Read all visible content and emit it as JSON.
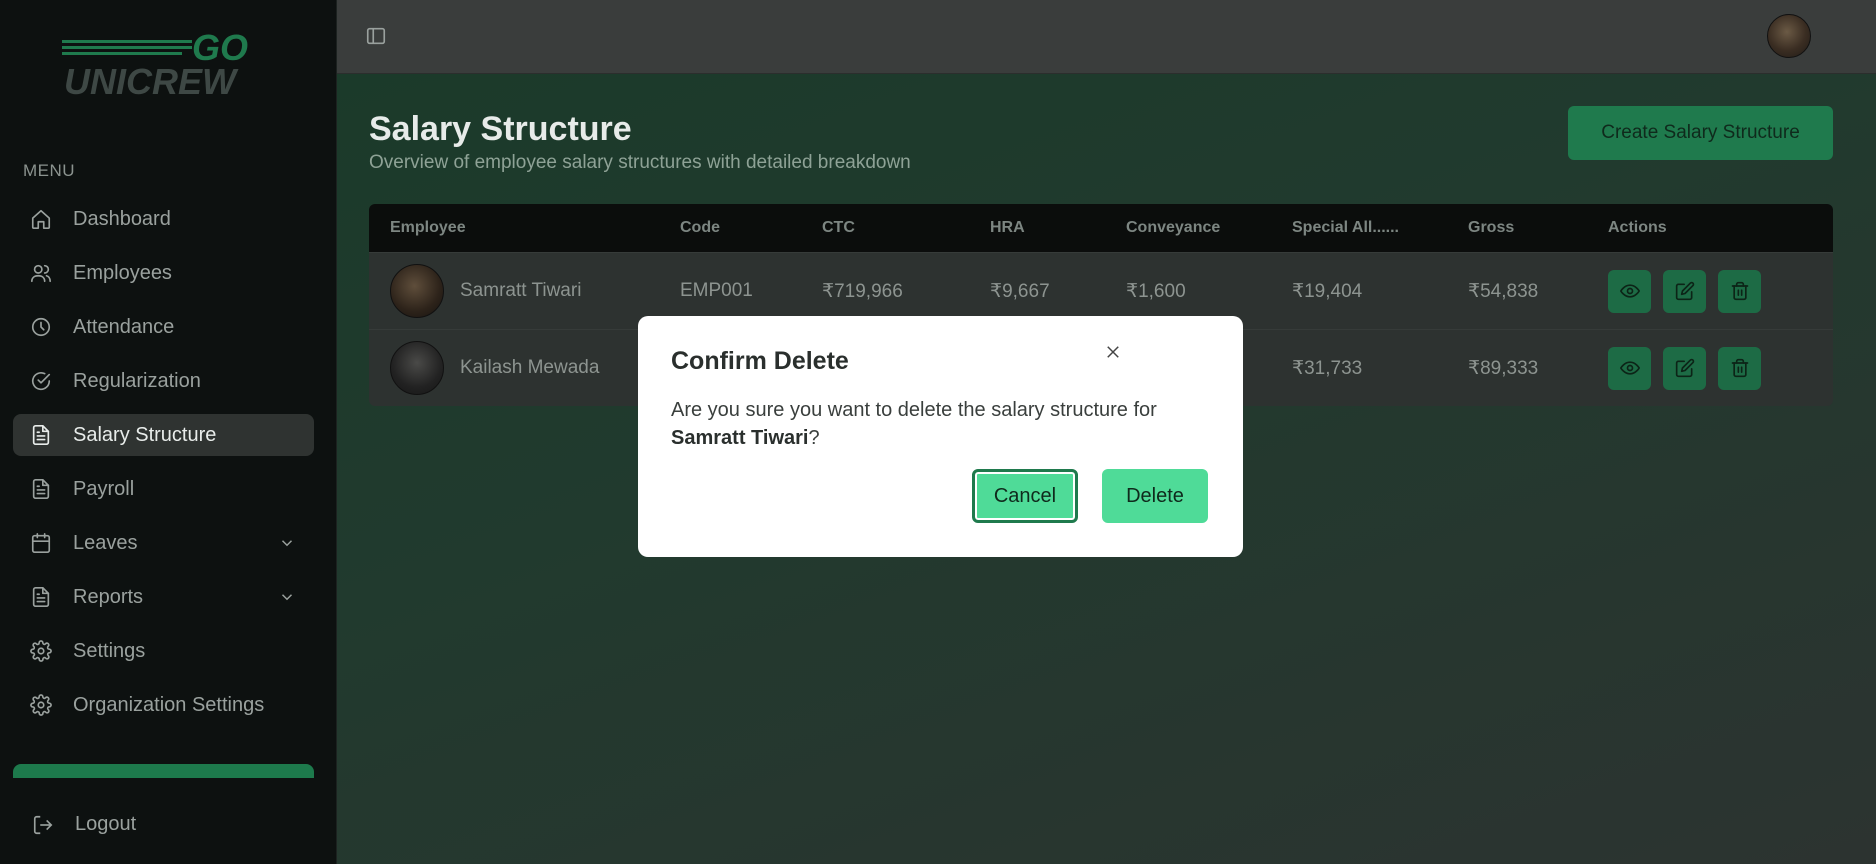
{
  "app": {
    "logo_text_top": "GO",
    "logo_text_bottom": "UNICREW",
    "brand_color": "#1f7a4d",
    "accent_color": "#4fdb98"
  },
  "sidebar": {
    "menu_label": "MENU",
    "items": [
      {
        "label": "Dashboard",
        "icon": "home-icon",
        "active": false
      },
      {
        "label": "Employees",
        "icon": "users-icon",
        "active": false
      },
      {
        "label": "Attendance",
        "icon": "clock-icon",
        "active": false
      },
      {
        "label": "Regularization",
        "icon": "check-circle-icon",
        "active": false
      },
      {
        "label": "Salary Structure",
        "icon": "file-icon",
        "active": true
      },
      {
        "label": "Payroll",
        "icon": "file-icon",
        "active": false
      },
      {
        "label": "Leaves",
        "icon": "calendar-icon",
        "active": false,
        "has_chevron": true
      },
      {
        "label": "Reports",
        "icon": "file-icon",
        "active": false,
        "has_chevron": true
      },
      {
        "label": "Settings",
        "icon": "gear-icon",
        "active": false
      },
      {
        "label": "Organization Settings",
        "icon": "gear-icon",
        "active": false
      }
    ],
    "logout_label": "Logout"
  },
  "page": {
    "title": "Salary Structure",
    "subtitle": "Overview of employee salary structures with detailed breakdown",
    "create_button": "Create Salary Structure"
  },
  "table": {
    "headers": [
      "Employee",
      "Code",
      "CTC",
      "HRA",
      "Conveyance",
      "Special All......",
      "Gross",
      "Actions"
    ],
    "rows": [
      {
        "name": "Samratt Tiwari",
        "code": "EMP001",
        "ctc": "₹719,966",
        "hra": "₹9,667",
        "conveyance": "₹1,600",
        "special": "₹19,404",
        "gross": "₹54,838"
      },
      {
        "name": "Kailash Mewada",
        "code": "",
        "ctc": "",
        "hra": "",
        "conveyance": "",
        "special": "₹31,733",
        "gross": "₹89,333"
      }
    ]
  },
  "modal": {
    "title": "Confirm Delete",
    "message_prefix": "Are you sure you want to delete the salary structure for ",
    "employee_name": "Samratt Tiwari",
    "message_suffix": "?",
    "cancel_label": "Cancel",
    "delete_label": "Delete"
  }
}
